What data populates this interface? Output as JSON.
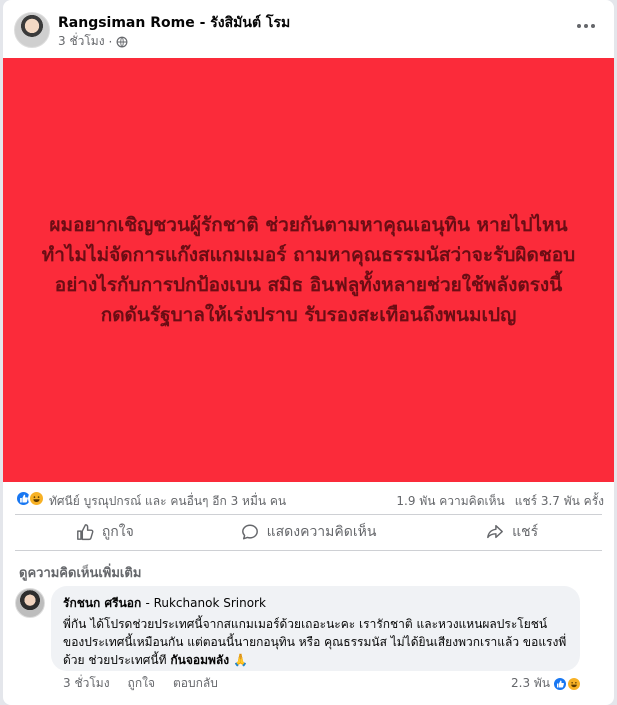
{
  "post": {
    "author": "Rangsiman Rome - รังสิมันต์ โรม",
    "time": "3 ชั่วโมง",
    "privacy_icon": "globe-icon",
    "background_color": "#fb2b3a",
    "text": "ผมอยากเชิญชวนผู้รักชาติ ช่วยกันตามหาคุณเอนุทิน หายไปไหน ทำไมไม่จัดการแก๊งสแกมเมอร์ ถามหาคุณธรรมนัสว่าจะรับผิดชอบอย่างไรกับการปกป้องเบน สมิธ อินฟลูทั้งหลายช่วยใช้พลังตรงนี้กดดันรัฐบาลให้เร่งปราบ รับรองสะเทือนถึงพนมเปญ"
  },
  "reactions": {
    "summary": "ทัศนีย์ บูรณุปกรณ์ และ คนอื่นๆ อีก 3 หมื่น คน",
    "comments_count": "1.9 พัน ความคิดเห็น",
    "shares_count": "แชร์ 3.7 พัน ครั้ง",
    "icons": [
      "like-icon",
      "haha-icon"
    ]
  },
  "actions": {
    "like": "ถูกใจ",
    "comment": "แสดงความคิดเห็น",
    "share": "แชร์"
  },
  "comments": {
    "more_label": "ดูความคิดเห็นเพิ่มเติม",
    "items": [
      {
        "name_thai": "รักชนก ศรีนอก",
        "name_latin": "- Rukchanok Srinork",
        "text": "พี่กัน ได้โปรดช่วยประเทศนี้จากสแกมเมอร์ด้วยเถอะนะคะ เรารักชาติ และหวงแหนผลประโยชน์ของประเทศนี้เหมือนกัน แต่ตอนนี้นายกอนุทิน หรือ คุณธรรมนัส ไม่ได้ยินเสียงพวกเราแล้ว ขอแรงพี่ด้วย ช่วยประเทศนี้ที ",
        "text_bold": "กันจอมพลัง",
        "emoji": "🙏",
        "time": "3 ชั่วโมง",
        "like": "ถูกใจ",
        "reply": "ตอบกลับ",
        "reaction_count": "2.3 พัน"
      }
    ]
  },
  "colors": {
    "accent": "#1877f2",
    "post_text": "#6b0d14"
  }
}
